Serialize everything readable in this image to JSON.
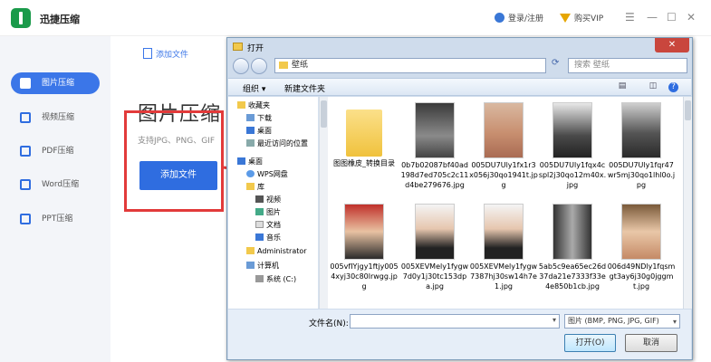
{
  "app": {
    "title": "迅捷压缩",
    "login": "登录/注册",
    "vip": "购买VIP",
    "win_menu": "☰",
    "win_min": "—",
    "win_max": "☐",
    "win_close": "✕"
  },
  "sidebar": {
    "items": [
      {
        "label": "图片压缩",
        "active": true
      },
      {
        "label": "视频压缩",
        "active": false
      },
      {
        "label": "PDF压缩",
        "active": false
      },
      {
        "label": "Word压缩",
        "active": false
      },
      {
        "label": "PPT压缩",
        "active": false
      }
    ]
  },
  "main": {
    "tab_add": "添加文件",
    "title": "图片压缩",
    "support": "支持JPG、PNG、GIF",
    "add_button": "添加文件"
  },
  "dialog": {
    "title": "打开",
    "close": "✕",
    "address": "壁纸",
    "search_placeholder": "搜索 壁纸",
    "toolbar": {
      "organize": "组织 ▾",
      "new_folder": "新建文件夹",
      "help": "?"
    },
    "tree": [
      "收藏夹",
      "下载",
      "桌面",
      "最近访问的位置",
      "桌面",
      "WPS网盘",
      "库",
      "视频",
      "图片",
      "文档",
      "音乐",
      "Administrator",
      "计算机",
      "系统 (C:)"
    ],
    "files": [
      {
        "name": "图图橡皮_转换目录",
        "type": "folder"
      },
      {
        "name": "0b7b02087bf40ad198d7ed705c2c11d4be279676.jpg",
        "type": "image"
      },
      {
        "name": "005DU7Uly1fx1r3x056j30qo1941t.jpg",
        "type": "image"
      },
      {
        "name": "005DU7Uly1fqx4cspl2j30qo12m40x.jpg",
        "type": "image"
      },
      {
        "name": "005DU7Uly1fqr47wr5mj30qo1lhl0o.jpg",
        "type": "image"
      },
      {
        "name": "005vfIYjgy1ftjy0054xyj30c80lrwgg.jpg",
        "type": "image"
      },
      {
        "name": "005XEVMely1fygw7d0y1j30tc153dpa.jpg",
        "type": "image"
      },
      {
        "name": "005XEVMely1fygw7387hj30sw14h7e1.jpg",
        "type": "image"
      },
      {
        "name": "5ab5c9ea65ec26d37da21e7333f33e4e850b1cb.jpg",
        "type": "image"
      },
      {
        "name": "006d49NDly1fqsmgt3ay6j30g0jggmt.jpg",
        "type": "image"
      }
    ],
    "filename_label": "文件名(N):",
    "filename_value": "",
    "filetype": "图片 (BMP, PNG, JPG, GIF)",
    "open_button": "打开(O)",
    "cancel_button": "取消"
  }
}
